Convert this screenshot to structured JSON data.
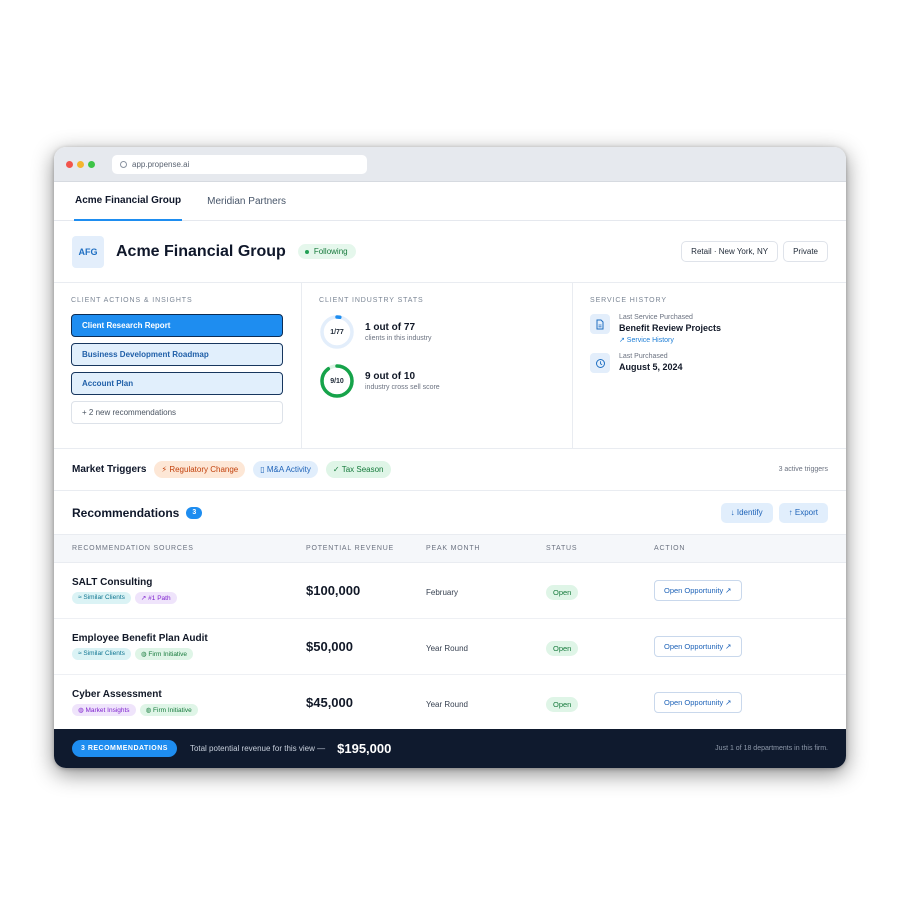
{
  "browser": {
    "url": "app.propense.ai"
  },
  "tabs": [
    {
      "label": "Acme Financial Group"
    },
    {
      "label": "Meridian Partners"
    }
  ],
  "company": {
    "initials": "AFG",
    "name": "Acme Financial Group",
    "follow_status": "Following",
    "location_chip": "Retail · New York, NY",
    "type_chip": "Private"
  },
  "client_actions": {
    "label": "CLIENT ACTIONS & INSIGHTS",
    "items": [
      "Client Research Report",
      "Business Development Roadmap",
      "Account Plan"
    ],
    "more": "+ 2 new recommendations"
  },
  "industry_stats": {
    "label": "CLIENT INDUSTRY STATS",
    "stats": [
      {
        "ring": "1/77",
        "fraction": 0.013,
        "main": "1 out of 77",
        "sub": "clients in this industry",
        "color": "#1e8df0"
      },
      {
        "ring": "9/10",
        "fraction": 0.9,
        "main": "9 out of 10",
        "sub": "industry cross sell score",
        "color": "#16a34a"
      }
    ]
  },
  "service_history": {
    "label": "SERVICE HISTORY",
    "last_service_label": "Last Service Purchased",
    "last_service_value": "Benefit Review Projects",
    "link": "↗ Service History",
    "last_purchased_label": "Last Purchased",
    "last_purchased_value": "August 5, 2024"
  },
  "triggers": {
    "title": "Market Triggers",
    "items": [
      "⚡ Regulatory Change",
      "▯ M&A Activity",
      "✓ Tax Season"
    ],
    "count": "3 active triggers"
  },
  "recommendations": {
    "title": "Recommendations",
    "count": "3",
    "identify": "↓ Identify",
    "export": "↑ Export",
    "columns": [
      "RECOMMENDATION SOURCES",
      "POTENTIAL REVENUE",
      "PEAK MONTH",
      "STATUS",
      "ACTION"
    ],
    "rows": [
      {
        "title": "SALT Consulting",
        "tags": [
          "≈ Similar Clients",
          "↗ #1 Path"
        ],
        "revenue": "$100,000",
        "peak": "February",
        "status": "Open",
        "action": "Open Opportunity ↗"
      },
      {
        "title": "Employee Benefit Plan Audit",
        "tags": [
          "≈ Similar Clients",
          "◍ Firm Initiative"
        ],
        "revenue": "$50,000",
        "peak": "Year Round",
        "status": "Open",
        "action": "Open Opportunity ↗"
      },
      {
        "title": "Cyber Assessment",
        "tags": [
          "◍ Market Insights",
          "◍ Firm Initiative"
        ],
        "revenue": "$45,000",
        "peak": "Year Round",
        "status": "Open",
        "action": "Open Opportunity ↗"
      }
    ]
  },
  "footer": {
    "badge": "3 RECOMMENDATIONS",
    "text": "Total potential revenue for this view —",
    "total": "$195,000",
    "note": "Just 1 of 18 departments in this firm."
  },
  "colors": {
    "accent": "#1e8df0",
    "footer_bg": "#0f1a2e",
    "success": "#16a34a"
  }
}
